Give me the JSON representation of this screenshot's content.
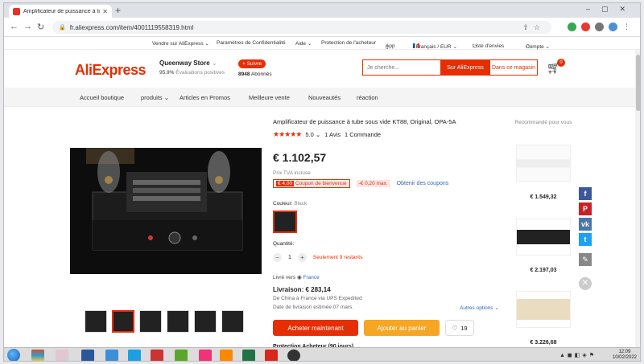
{
  "browser": {
    "tab_title": "Amplificateur de puissance à tube",
    "url": "fr.aliexpress.com/item/4001119558319.html"
  },
  "topstrip": {
    "sell": "Vendre sur AliExpress ⌄",
    "privacy": "Paramètres de Confidentialité",
    "help": "Aide ⌄",
    "protection": "Protection de l'acheteur",
    "app": "App",
    "locale": "/ Français / EUR ⌄",
    "wishlist": "Liste d'envies",
    "account": "Compte ⌄"
  },
  "header": {
    "logo": "AliExpress",
    "store_name": "Queenway Store",
    "positive_pct": "95.9%",
    "positive_label": "Évaluations positives",
    "follow_label": "+ Suivre",
    "subscribers": "8948",
    "subscribers_label": "Abonnés",
    "search_placeholder": "Je cherche...",
    "search_ali": "Sur AliExpress",
    "search_store": "Dans ce magasin",
    "cart_count": "0"
  },
  "storenav": [
    "Accueil boutique",
    "produits ⌄",
    "Articles en Promos",
    "Meilleure vente",
    "Nouveautés",
    "réaction"
  ],
  "product": {
    "title": "Amplificateur de puissance à tube sous vide KT88, Original, OPA-5A",
    "rating": "5.0 ⌄",
    "reviews": "1 Avis",
    "orders": "1 Commande",
    "price": "€ 1.102,57",
    "tva": "Prix TVA incluse",
    "coupon1_prefix": "€ 4,00",
    "coupon1_text": "Coupon de bienvenue",
    "coupon2": "-€ 0,20 max.",
    "coupon_link": "Obtenir des coupons",
    "color_label": "Couleur:",
    "color_value": "Black",
    "qty_label": "Quantité:",
    "qty_value": "1",
    "qty_note": "Seulement 9 restants",
    "ship_to_label": "Livré vers",
    "ship_to_country": "France",
    "delivery": "Livraison: € 283,14",
    "delivery_route": "De China à France via UPS Expedited",
    "delivery_date": "Date de livraison estimée 07 mars.",
    "more_options": "Autres options ⌄",
    "buy_now": "Acheter maintenant",
    "add_to_cart": "Ajouter au panier",
    "wish_count": "19",
    "protection": "Protection Acheteur (90 jours)"
  },
  "recommended": {
    "title": "Recommandé pour vous",
    "prices": [
      "€ 1.549,32",
      "€ 2.197,03",
      "€ 3.226,68"
    ]
  },
  "taskbar": {
    "time": "12:09",
    "date": "10/02/2022"
  }
}
